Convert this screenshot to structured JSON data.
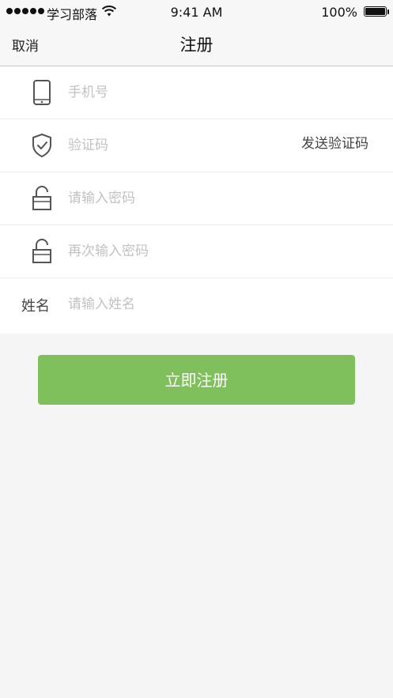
{
  "status_bar": {
    "carrier": "学习部落",
    "time": "9:41 AM",
    "battery": "100%"
  },
  "nav": {
    "cancel_label": "取消",
    "title": "注册"
  },
  "form": {
    "phone_placeholder": "手机号",
    "code_placeholder": "验证码",
    "send_code_label": "发送验证码",
    "password_placeholder": "请输入密码",
    "confirm_password_placeholder": "再次输入密码",
    "name_label": "姓名",
    "name_placeholder": "请输入姓名"
  },
  "submit_label": "立即注册",
  "colors": {
    "accent": "#7fbf5c",
    "background": "#f5f5f5"
  },
  "icons": {
    "phone": "mobile-phone-icon",
    "code": "shield-check-icon",
    "password": "unlock-icon",
    "confirm_password": "unlock-icon",
    "wifi": "wifi-icon"
  }
}
